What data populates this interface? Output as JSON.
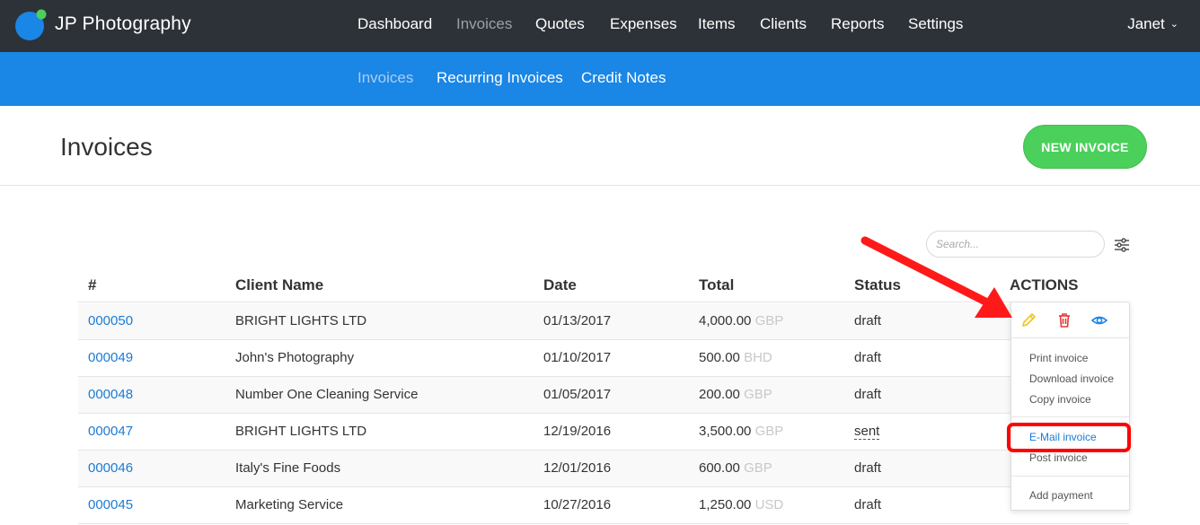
{
  "app": {
    "brand": "JP Photography"
  },
  "nav": {
    "items": [
      "Dashboard",
      "Invoices",
      "Quotes",
      "Expenses",
      "Items",
      "Clients",
      "Reports",
      "Settings"
    ],
    "active": "Invoices",
    "user": "Janet",
    "user_chevron": "⌄"
  },
  "subnav": {
    "items": [
      "Invoices",
      "Recurring Invoices",
      "Credit Notes"
    ],
    "active": "Invoices"
  },
  "page": {
    "title": "Invoices",
    "new_button": "NEW INVOICE",
    "search_placeholder": "Search..."
  },
  "table": {
    "headers": [
      "#",
      "Client Name",
      "Date",
      "Total",
      "Status",
      "ACTIONS"
    ],
    "rows": [
      {
        "number": "000050",
        "client": "BRIGHT LIGHTS LTD",
        "date": "01/13/2017",
        "amount": "4,000.00",
        "currency": "GBP",
        "status": "draft"
      },
      {
        "number": "000049",
        "client": "John's Photography",
        "date": "01/10/2017",
        "amount": "500.00",
        "currency": "BHD",
        "status": "draft"
      },
      {
        "number": "000048",
        "client": "Number One Cleaning Service",
        "date": "01/05/2017",
        "amount": "200.00",
        "currency": "GBP",
        "status": "draft"
      },
      {
        "number": "000047",
        "client": "BRIGHT LIGHTS LTD",
        "date": "12/19/2016",
        "amount": "3,500.00",
        "currency": "GBP",
        "status": "sent"
      },
      {
        "number": "000046",
        "client": "Italy's Fine Foods",
        "date": "12/01/2016",
        "amount": "600.00",
        "currency": "GBP",
        "status": "draft"
      },
      {
        "number": "000045",
        "client": "Marketing Service",
        "date": "10/27/2016",
        "amount": "1,250.00",
        "currency": "USD",
        "status": "draft"
      }
    ]
  },
  "actions_menu": {
    "icons": [
      "pencil-icon",
      "trash-icon",
      "eye-icon"
    ],
    "items": [
      "Print invoice",
      "Download invoice",
      "Copy invoice",
      "E-Mail invoice",
      "Post invoice",
      "Add payment"
    ]
  },
  "colors": {
    "topbar": "#2d3238",
    "subbar": "#1a86e6",
    "new_button": "#4cd05c",
    "link": "#1a7bd6",
    "highlight": "#ff0000",
    "edit": "#f0c419",
    "delete": "#e53935",
    "view": "#1a86e6"
  }
}
